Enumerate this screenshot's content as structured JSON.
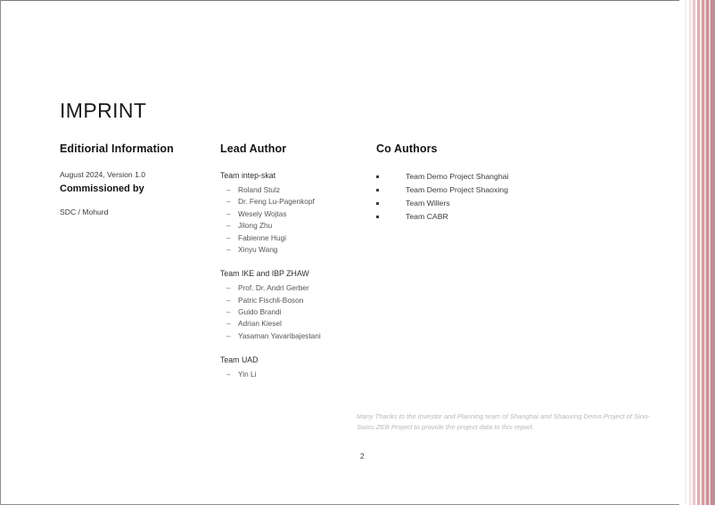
{
  "page": {
    "title": "IMPRINT",
    "number": "2",
    "background": "#ffffff",
    "accent_color": "#d89aa0"
  },
  "editorial": {
    "heading": "Editiorial Information",
    "version_line": "August 2024, Version 1.0",
    "commissioned_heading": "Commissioned by",
    "commissioned_by": "SDC / Mohurd"
  },
  "lead_author": {
    "heading": "Lead Author",
    "teams": [
      {
        "name": "Team intep-skat",
        "bullet": "–",
        "members": [
          "Roland Stulz",
          "Dr. Feng Lu-Pagenkopf",
          "Wesely Wojtas",
          "Jilong Zhu",
          "Fabienne Hugi",
          "Xinyu Wang"
        ]
      },
      {
        "name": "Team IKE and IBP ZHAW",
        "bullet": "–",
        "members": [
          "Prof. Dr. Andri Gerber",
          "Patric Fischli-Boson",
          "Guido Brandi",
          "Adrian Kiesel",
          "Yasaman Yavaribajestani"
        ]
      },
      {
        "name": "Team UAD",
        "bullet": "–",
        "members": [
          "Yin Li"
        ]
      }
    ]
  },
  "co_authors": {
    "heading": "Co Authors",
    "items": [
      "Team Demo Project Shanghai",
      "Team Demo Project Shaoxing",
      "Team Willers",
      "Team CABR"
    ]
  },
  "acknowledgement": "Many Thanks to the Investor and Planning team of Shanghai and Shaoxing Demo Project of Sino-Swiss ZEB Project to provide the project data to this report.",
  "decoration": {
    "stripes": [
      {
        "width": 6,
        "color": "#ffffff"
      },
      {
        "width": 2,
        "color": "#f7eff0"
      },
      {
        "width": 3,
        "color": "#ffffff"
      },
      {
        "width": 2,
        "color": "#f0e0e1"
      },
      {
        "width": 2,
        "color": "#fbf5f5"
      },
      {
        "width": 3,
        "color": "#e9c9cc"
      },
      {
        "width": 2,
        "color": "#fdf8f8"
      },
      {
        "width": 3,
        "color": "#ddaeb3"
      },
      {
        "width": 2,
        "color": "#f6ecec"
      },
      {
        "width": 3,
        "color": "#d79aa0"
      },
      {
        "width": 2,
        "color": "#efdcdd"
      },
      {
        "width": 3,
        "color": "#cf8e95"
      },
      {
        "width": 2,
        "color": "#e7d0d2"
      },
      {
        "width": 3,
        "color": "#c98a91"
      },
      {
        "width": 2,
        "color": "#b0949b"
      }
    ]
  }
}
